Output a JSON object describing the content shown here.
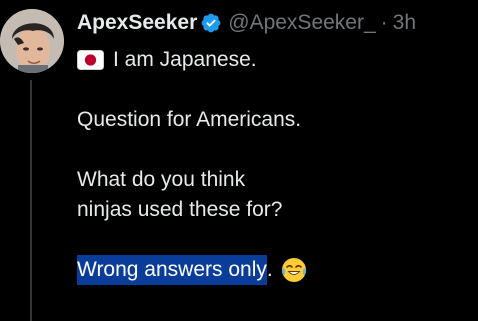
{
  "author": {
    "display_name": "ApexSeeker",
    "handle": "@ApexSeeker_",
    "separator": "·",
    "time": "3h",
    "verified": true
  },
  "tweet": {
    "flag_icon": "japan-flag-icon",
    "line1": "I am Japanese.",
    "line2": "Question for Americans.",
    "line3": "What do you think",
    "line4": "ninjas used these for?",
    "line5_highlighted": "Wrong answers only",
    "line5_tail": ".",
    "emoji_icon": "face-with-tears-of-joy-icon"
  },
  "colors": {
    "background": "#000000",
    "text": "#e7e9ea",
    "muted": "#71767b",
    "verified_badge": "#1d9bf0",
    "selection_highlight": "#0a3d99",
    "flag_red": "#bc002d",
    "thread_line": "#333639"
  }
}
